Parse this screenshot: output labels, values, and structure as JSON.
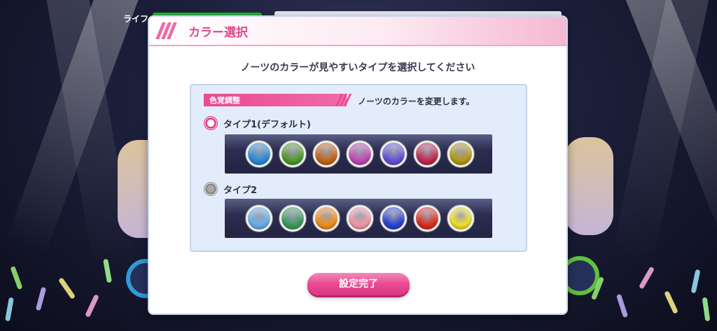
{
  "hud": {
    "life_label": "ライフ"
  },
  "dialog": {
    "title": "カラー選択",
    "subtitle": "ノーツのカラーが見やすいタイプを選択してください",
    "section_label": "色覚調整",
    "section_description": "ノーツのカラーを変更します。",
    "types": [
      {
        "label": "タイプ1(デフォルト)",
        "selected": true,
        "note_colors": [
          "#2b8ad6",
          "#4f9a2c",
          "#c4651a",
          "#c04ab4",
          "#6552d6",
          "#c1294f",
          "#b29b1a"
        ]
      },
      {
        "label": "タイプ2",
        "selected": false,
        "note_colors": [
          "#6aaee8",
          "#3c9a5e",
          "#f0901c",
          "#ef9aa8",
          "#2a44d0",
          "#dd2e1e",
          "#efe22a"
        ]
      }
    ],
    "confirm_label": "設定完了"
  },
  "colors": {
    "accent": "#e94a93",
    "panel": "#e3ecfa"
  }
}
